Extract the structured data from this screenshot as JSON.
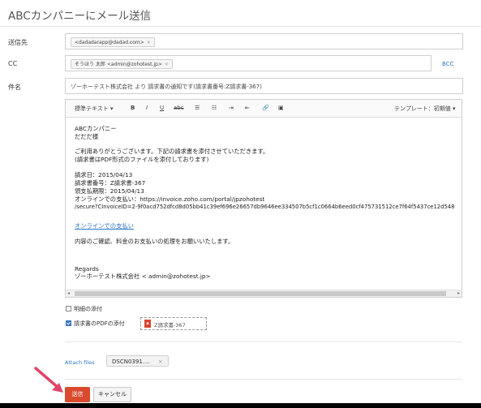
{
  "page": {
    "title": "ABCカンパニーにメール送信"
  },
  "fields": {
    "to_label": "送信先",
    "to_chip": "<dadadarapp@dadad.com>",
    "cc_label": "CC",
    "cc_chip": "そうほう 太郎 <admin@zohotest.jp>",
    "bcc_label": "BCC",
    "subject_label": "件名",
    "subject_value": "ゾーホーテスト株式会社 より 請求書の通知です(請求書番号:Z請求書-367)"
  },
  "toolbar": {
    "format_label": "標準テキスト",
    "bold": "B",
    "italic": "I",
    "underline": "U",
    "strike": "abc",
    "template_label": "テンプレート：初期値"
  },
  "body": {
    "line1": "ABCカンパニー",
    "line2": "だだだ様",
    "line3": "ご利用ありがとうございます。下記の請求書を添付させていただきます。",
    "line4": "(請求書はPDF形式のファイルを添付しております)",
    "line5": "請求日：2015/04/13",
    "line6": "請求書番号：Z請求書-367",
    "line7": "領支払期限：2015/04/13",
    "line8": "オンラインでの支払い：https://invoice.zoho.com/portal/jpzohotest",
    "line9": "/secure?CInvoiceID=2-9f0acd752dfcd8d05bb41c39ef696e26657db9646ee334507b5cf1c0664b6eed0cf475731512ce7f64f5437ce12d548",
    "link": "オンラインでの支払い",
    "line10": "内容のご確認、料金のお支払いの処理をお願いいたします。",
    "line11": "Regards",
    "line12": "ゾーホーテスト株式会社 < admin@zohotest.jp>"
  },
  "options": {
    "statement_label": "明細の添付",
    "statement_checked": false,
    "pdf_label": "請求書のPDFの添付",
    "pdf_checked": true,
    "pdf_file": "Z請求書-367"
  },
  "attachments": {
    "attach_label": "Attach files",
    "file_name": "DSCN0391...."
  },
  "actions": {
    "send_label": "送信",
    "cancel_label": "キャンセル"
  },
  "colors": {
    "primary_button": "#d94a2e",
    "link": "#2a76c6",
    "arrow": "#e0456a"
  }
}
